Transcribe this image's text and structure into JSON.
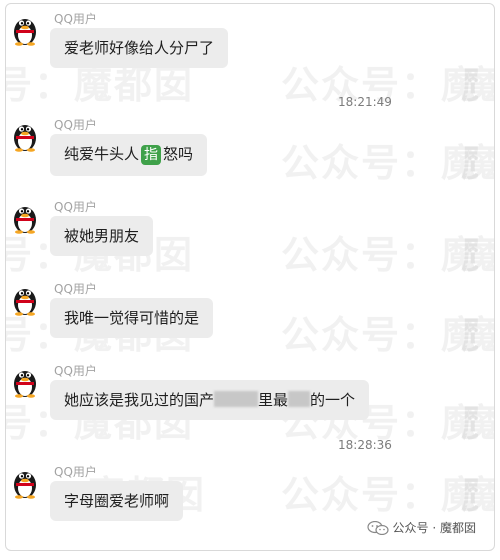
{
  "watermark": {
    "text_a": "号：魔都囡",
    "text_b": "公众号：魔",
    "text_c": "魔",
    "text_d": "魔都囡"
  },
  "messages": [
    {
      "sender": "QQ用户",
      "text": "爱老师好像给人分尸了"
    },
    {
      "sender": "QQ用户",
      "text_before": "纯爱牛头人",
      "badge": "指",
      "text_after": "怒吗"
    },
    {
      "sender": "QQ用户",
      "text": "被她男朋友"
    },
    {
      "sender": "QQ用户",
      "text": "我唯一觉得可惜的是"
    },
    {
      "sender": "QQ用户",
      "text_before": "她应该是我见过的国产",
      "text_middle": "里最",
      "text_after": "的一个"
    },
    {
      "sender": "QQ用户",
      "text": "字母圈爱老师啊"
    }
  ],
  "timestamps": [
    "18:21:49",
    "18:28:36"
  ],
  "footer": {
    "icon": "wechat-icon",
    "label": "公众号 · 魔都囡"
  },
  "colors": {
    "bubble": "#ececec",
    "badge": "#3fa14a",
    "sender": "#a3a3a3"
  }
}
